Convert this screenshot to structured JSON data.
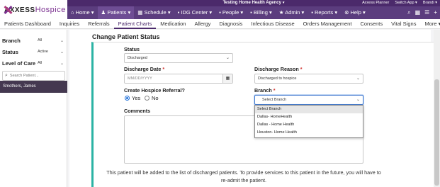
{
  "brand": {
    "name": "AXXESS",
    "product": "Hospice"
  },
  "agency": {
    "name": "Testing Home Health Agency",
    "caret": "▾"
  },
  "top_links": [
    "Axxess Planner",
    "Switch App ▾",
    "Brandi ▾"
  ],
  "main_nav": [
    "Home",
    "Patients",
    "Schedule",
    "IDG Center",
    "People",
    "Billing",
    "Admin",
    "Reports",
    "Help"
  ],
  "sub_nav": {
    "items": [
      "Patients Dashboard",
      "Inquiries",
      "Referrals",
      "Patient Charts",
      "Medication",
      "Allergy",
      "Diagnosis",
      "Infectious Disease",
      "Orders Management",
      "Consents",
      "Vital Signs",
      "More ▾"
    ],
    "active": "Patient Charts"
  },
  "sidebar": {
    "filters": [
      {
        "label": "Branch",
        "value": "All"
      },
      {
        "label": "Status",
        "value": "Active"
      },
      {
        "label": "Level of Care",
        "value": "All"
      }
    ],
    "search_placeholder": "Search Patient...",
    "patient": "Smothers, James"
  },
  "form": {
    "title": "Change Patient Status",
    "status": {
      "label": "Status",
      "value": "Discharged"
    },
    "discharge_date": {
      "label": "Discharge Date",
      "placeholder": "MM/DD/YYYY"
    },
    "discharge_reason": {
      "label": "Discharge Reason",
      "value": "Discharged to hospice"
    },
    "hospice_referral": {
      "label": "Create Hospice Referral?",
      "options": [
        "Yes",
        "No"
      ],
      "selected": "Yes"
    },
    "branch": {
      "label": "Branch",
      "value": "Select Branch",
      "options": [
        "Select Branch",
        "Dallas- HomeHealth",
        "Dallas - Home Health",
        "Houston- Home Health"
      ],
      "highlighted": "Select Branch"
    },
    "comments": {
      "label": "Comments"
    },
    "note": "This patient will be added to the list of discharged patients. To provide services to this patient in the future, you will have to re-admit the patient."
  },
  "colors": {
    "nav_bg": "#5b3d7e",
    "agency_bg": "#4b2a6b",
    "accent_teal": "#2bb3a4",
    "required": "#d0312d"
  }
}
